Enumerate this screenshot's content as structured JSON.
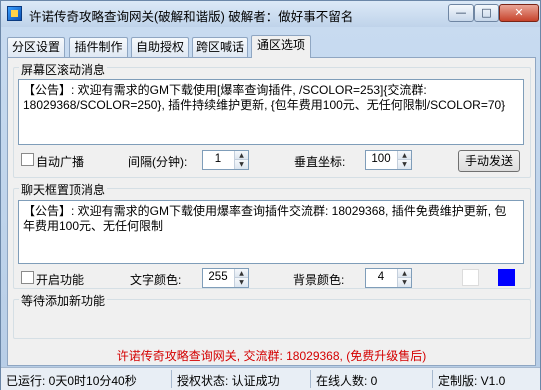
{
  "window": {
    "title": "许诺传奇攻略查询网关(破解和谐版) 破解者：做好事不留名",
    "controls": {
      "minimize": "—",
      "maximize": "□",
      "close": "✕"
    },
    "icon": "app-icon"
  },
  "tabs": [
    {
      "label": "分区设置"
    },
    {
      "label": "插件制作"
    },
    {
      "label": "自助授权"
    },
    {
      "label": "跨区喊话"
    },
    {
      "label": "通区选项",
      "active": true
    }
  ],
  "scroll_section": {
    "title": "屏幕区滚动消息",
    "message_line1": "【公告】: 欢迎有需求的GM下载使用[爆率查询插件, /SCOLOR=253]{交流群:",
    "message_line2": "18029368/SCOLOR=250}, 插件持续维护更新, {包年费用100元、无任何限制/SCOLOR=70}",
    "auto_broadcast_label": "自动广播",
    "auto_broadcast_checked": false,
    "interval_label": "间隔(分钟):",
    "interval_value": "1",
    "vertical_label": "垂直坐标:",
    "vertical_value": "100",
    "manual_send_label": "手动发送"
  },
  "chat_section": {
    "title": "聊天框置顶消息",
    "message_line1": "【公告】: 欢迎有需求的GM下载使用爆率查询插件交流群: 18029368, 插件免费维护更新, 包",
    "message_line2": "年费用100元、无任何限制",
    "enable_label": "开启功能",
    "enable_checked": false,
    "text_color_label": "文字颜色:",
    "text_color_value": "255",
    "bg_color_label": "背景颜色:",
    "bg_color_value": "4",
    "swatch_colors": [
      "#ffffff",
      "#0000ff"
    ]
  },
  "pending_section": {
    "title": "等待添加新功能"
  },
  "notice": "许诺传奇攻略查询网关, 交流群: 18029368, (免费升级售后)",
  "status": {
    "uptime": "已运行: 0天0时10分40秒",
    "auth": "授权状态: 认证成功",
    "online": "在线人数: 0",
    "edition": "定制版: V1.0"
  }
}
